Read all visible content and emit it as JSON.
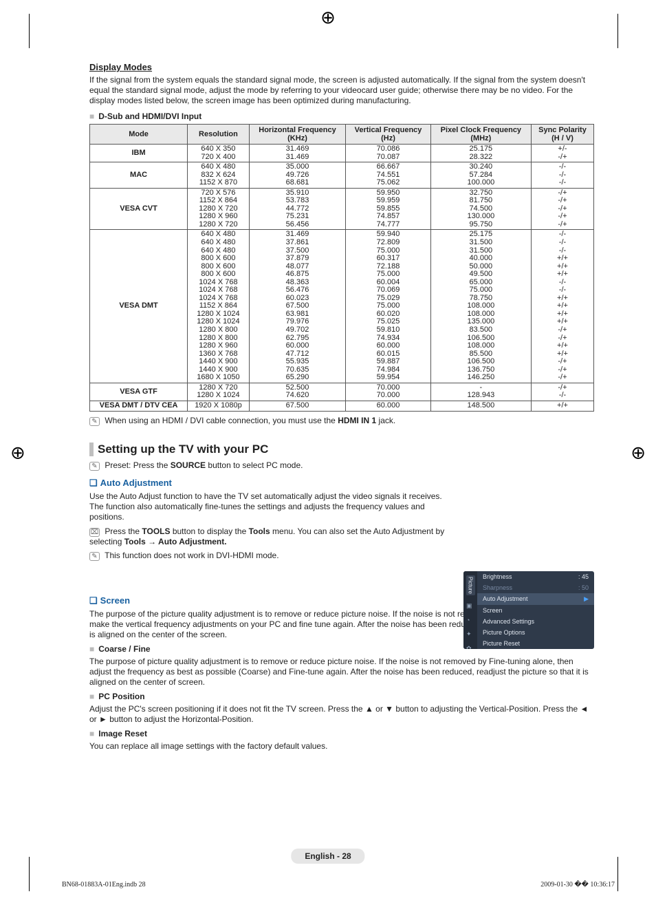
{
  "header": {
    "display_modes": "Display Modes",
    "intro": "If the signal from the system equals the standard signal mode, the screen is adjusted automatically. If the signal from the system doesn't equal the standard signal mode, adjust the mode by referring to your videocard user guide; otherwise there may be no video. For the display modes listed below, the screen image has been optimized during manufacturing.",
    "sub_bullet": "D-Sub and HDMI/DVI Input"
  },
  "chart_data": {
    "type": "table",
    "columns": [
      "Mode",
      "Resolution",
      "Horizontal Frequency (KHz)",
      "Vertical Frequency (Hz)",
      "Pixel Clock Frequency (MHz)",
      "Sync Polarity (H / V)"
    ],
    "groups": [
      {
        "mode": "IBM",
        "rows": [
          {
            "res": "640 X 350",
            "h": "31.469",
            "v": "70.086",
            "p": "25.175",
            "s": "+/-"
          },
          {
            "res": "720 X 400",
            "h": "31.469",
            "v": "70.087",
            "p": "28.322",
            "s": "-/+"
          }
        ]
      },
      {
        "mode": "MAC",
        "rows": [
          {
            "res": "640 X 480",
            "h": "35.000",
            "v": "66.667",
            "p": "30.240",
            "s": "-/-"
          },
          {
            "res": "832 X 624",
            "h": "49.726",
            "v": "74.551",
            "p": "57.284",
            "s": "-/-"
          },
          {
            "res": "1152 X 870",
            "h": "68.681",
            "v": "75.062",
            "p": "100.000",
            "s": "-/-"
          }
        ]
      },
      {
        "mode": "VESA CVT",
        "rows": [
          {
            "res": "720 X 576",
            "h": "35.910",
            "v": "59.950",
            "p": "32.750",
            "s": "-/+"
          },
          {
            "res": "1152 X 864",
            "h": "53.783",
            "v": "59.959",
            "p": "81.750",
            "s": "-/+"
          },
          {
            "res": "1280 X 720",
            "h": "44.772",
            "v": "59.855",
            "p": "74.500",
            "s": "-/+"
          },
          {
            "res": "1280 X 960",
            "h": "75.231",
            "v": "74.857",
            "p": "130.000",
            "s": "-/+"
          },
          {
            "res": "1280 X 720",
            "h": "56.456",
            "v": "74.777",
            "p": "95.750",
            "s": "-/+"
          }
        ]
      },
      {
        "mode": "VESA DMT",
        "rows": [
          {
            "res": "640 X 480",
            "h": "31.469",
            "v": "59.940",
            "p": "25.175",
            "s": "-/-"
          },
          {
            "res": "640 X 480",
            "h": "37.861",
            "v": "72.809",
            "p": "31.500",
            "s": "-/-"
          },
          {
            "res": "640 X 480",
            "h": "37.500",
            "v": "75.000",
            "p": "31.500",
            "s": "-/-"
          },
          {
            "res": "800 X 600",
            "h": "37.879",
            "v": "60.317",
            "p": "40.000",
            "s": "+/+"
          },
          {
            "res": "800 X 600",
            "h": "48.077",
            "v": "72.188",
            "p": "50.000",
            "s": "+/+"
          },
          {
            "res": "800 X 600",
            "h": "46.875",
            "v": "75.000",
            "p": "49.500",
            "s": "+/+"
          },
          {
            "res": "1024 X 768",
            "h": "48.363",
            "v": "60.004",
            "p": "65.000",
            "s": "-/-"
          },
          {
            "res": "1024 X 768",
            "h": "56.476",
            "v": "70.069",
            "p": "75.000",
            "s": "-/-"
          },
          {
            "res": "1024 X 768",
            "h": "60.023",
            "v": "75.029",
            "p": "78.750",
            "s": "+/+"
          },
          {
            "res": "1152 X 864",
            "h": "67.500",
            "v": "75.000",
            "p": "108.000",
            "s": "+/+"
          },
          {
            "res": "1280 X 1024",
            "h": "63.981",
            "v": "60.020",
            "p": "108.000",
            "s": "+/+"
          },
          {
            "res": "1280 X 1024",
            "h": "79.976",
            "v": "75.025",
            "p": "135.000",
            "s": "+/+"
          },
          {
            "res": "1280 X 800",
            "h": "49.702",
            "v": "59.810",
            "p": "83.500",
            "s": "-/+"
          },
          {
            "res": "1280 X 800",
            "h": "62.795",
            "v": "74.934",
            "p": "106.500",
            "s": "-/+"
          },
          {
            "res": "1280 X 960",
            "h": "60.000",
            "v": "60.000",
            "p": "108.000",
            "s": "+/+"
          },
          {
            "res": "1360 X 768",
            "h": "47.712",
            "v": "60.015",
            "p": "85.500",
            "s": "+/+"
          },
          {
            "res": "1440 X 900",
            "h": "55.935",
            "v": "59.887",
            "p": "106.500",
            "s": "-/+"
          },
          {
            "res": "1440 X 900",
            "h": "70.635",
            "v": "74.984",
            "p": "136.750",
            "s": "-/+"
          },
          {
            "res": "1680 X 1050",
            "h": "65.290",
            "v": "59.954",
            "p": "146.250",
            "s": "-/+"
          }
        ]
      },
      {
        "mode": "VESA GTF",
        "rows": [
          {
            "res": "1280 X 720",
            "h": "52.500",
            "v": "70.000",
            "p": "-",
            "s": "-/+"
          },
          {
            "res": "1280 X 1024",
            "h": "74.620",
            "v": "70.000",
            "p": "128.943",
            "s": "-/-"
          }
        ]
      },
      {
        "mode": "VESA DMT / DTV CEA",
        "rows": [
          {
            "res": "1920 X 1080p",
            "h": "67.500",
            "v": "60.000",
            "p": "148.500",
            "s": "+/+"
          }
        ]
      }
    ]
  },
  "hdmi_note_prefix": "When using an HDMI / DVI cable connection, you must use the ",
  "hdmi_note_bold": "HDMI IN 1",
  "hdmi_note_suffix": " jack.",
  "section2": {
    "title": "Setting up the TV with your PC",
    "preset_prefix": "Preset: Press the ",
    "preset_bold": "SOURCE",
    "preset_suffix": " button to select PC mode."
  },
  "auto_adj": {
    "heading": "Auto Adjustment",
    "body": "Use the Auto Adjust function to have the TV set automatically adjust the video signals it receives. The function also automatically fine-tunes the settings and adjusts the frequency values and positions.",
    "tip_prefix": "Press the ",
    "tip_bold1": "TOOLS",
    "tip_mid": " button to display the ",
    "tip_bold2": "Tools",
    "tip_mid2": " menu. You can also set the Auto Adjustment by selecting ",
    "tip_bold3": "Tools → Auto Adjustment.",
    "note": "This function does not work in DVI-HDMI mode."
  },
  "osd": {
    "side_label": "Picture",
    "rows": [
      {
        "label": "Brightness",
        "val": ": 45",
        "muted": false
      },
      {
        "label": "Sharpness",
        "val": ": 50",
        "muted": true
      },
      {
        "label": "Auto Adjustment",
        "val": "",
        "sel": true,
        "arrow": true
      },
      {
        "label": "Screen",
        "val": "",
        "muted": false
      },
      {
        "label": "Advanced Settings",
        "val": "",
        "muted": false
      },
      {
        "label": "Picture Options",
        "val": "",
        "muted": false
      },
      {
        "label": "Picture Reset",
        "val": "",
        "muted": false
      }
    ]
  },
  "screen": {
    "heading": "Screen",
    "body": "The purpose of the picture quality adjustment is to remove or reduce picture noise. If the noise is not removed by fine tuning alone, then make the vertical frequency adjustments on your PC and fine tune again. After the noise has been reduced, re-adjust the picture so that it is aligned on the center of the screen."
  },
  "coarse": {
    "heading": "Coarse / Fine",
    "body": "The purpose of picture quality adjustment is to remove or reduce picture noise. If the noise is not removed by Fine-tuning alone, then adjust the frequency as best as possible (Coarse) and Fine-tune again. After the noise has been reduced, readjust the picture so that it is aligned on the center of screen."
  },
  "pcpos": {
    "heading": "PC Position",
    "body": "Adjust the PC's screen positioning if it does not fit the TV screen. Press the ▲ or ▼ button to adjusting the Vertical-Position. Press the ◄ or ► button to adjust the Horizontal-Position."
  },
  "imgreset": {
    "heading": "Image Reset",
    "body": "You can replace all image settings with the factory default values."
  },
  "footer": {
    "pageband": "English - 28",
    "left": "BN68-01883A-01Eng.indb   28",
    "right": "2009-01-30   �� 10:36:17"
  }
}
